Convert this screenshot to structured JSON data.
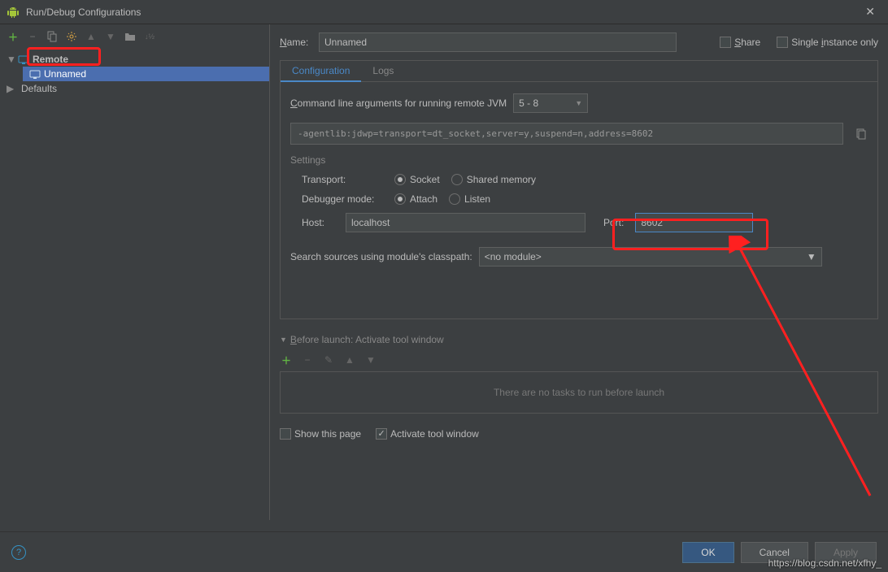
{
  "window": {
    "title": "Run/Debug Configurations"
  },
  "tree": {
    "remote": "Remote",
    "unnamed": "Unnamed",
    "defaults": "Defaults"
  },
  "form": {
    "name_label": "Name:",
    "name_value": "Unnamed",
    "share": "Share",
    "single_instance": "Single instance only",
    "tab_config": "Configuration",
    "tab_logs": "Logs",
    "cmdline_label": "Command line arguments for running remote JVM",
    "cmdline_value": "5 - 8",
    "agentlib": "-agentlib:jdwp=transport=dt_socket,server=y,suspend=n,address=8602",
    "settings_title": "Settings",
    "transport": "Transport:",
    "socket": "Socket",
    "shared_memory": "Shared memory",
    "debugger_mode": "Debugger mode:",
    "attach": "Attach",
    "listen": "Listen",
    "host": "Host:",
    "host_value": "localhost",
    "port": "Port:",
    "port_value": "8602",
    "search_sources": "Search sources using module's classpath:",
    "module_value": "<no module>",
    "before_launch": "Before launch: Activate tool window",
    "no_tasks": "There are no tasks to run before launch",
    "show_page": "Show this page",
    "activate_tool": "Activate tool window"
  },
  "buttons": {
    "ok": "OK",
    "cancel": "Cancel",
    "apply": "Apply"
  },
  "watermark": "https://blog.csdn.net/xfhy_"
}
